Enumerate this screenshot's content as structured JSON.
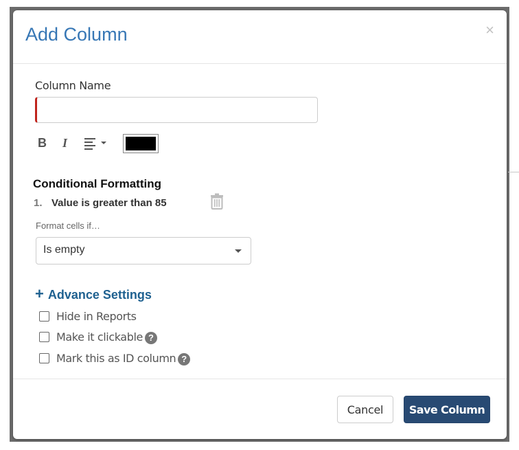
{
  "modal": {
    "title": "Add Column",
    "close_symbol": "×"
  },
  "column_name": {
    "label": "Column Name",
    "value": "",
    "placeholder": ""
  },
  "toolbar": {
    "bold": "B",
    "italic": "I",
    "align_icon": "align-left-icon",
    "color_value": "#000000"
  },
  "conditional_formatting": {
    "heading": "Conditional Formatting",
    "rules": [
      {
        "number": "1.",
        "text": "Value is greater than 85"
      }
    ],
    "format_label": "Format cells if…",
    "selected_option": "Is empty"
  },
  "advance_settings": {
    "label": "Advance Settings",
    "options": [
      {
        "label": "Hide in Reports",
        "checked": false,
        "help": false
      },
      {
        "label": "Make it clickable",
        "checked": false,
        "help": true
      },
      {
        "label": "Mark this as ID column",
        "checked": false,
        "help": true
      }
    ],
    "help_symbol": "?"
  },
  "footer": {
    "cancel_label": "Cancel",
    "save_label": "Save Column"
  },
  "colors": {
    "title": "#3777b5",
    "accent": "#1f6190",
    "primary_button": "#284a73",
    "required_marker": "#c0241d"
  }
}
